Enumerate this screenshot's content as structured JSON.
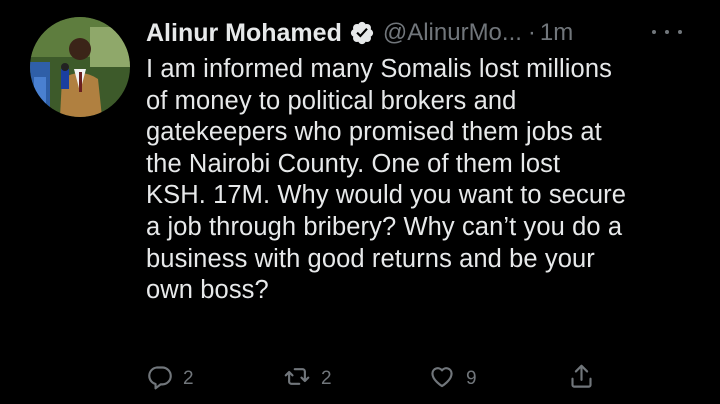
{
  "tweet": {
    "author_name": "Alinur Mohamed",
    "handle": "@AlinurMo...",
    "separator": "·",
    "timestamp": "1m",
    "verified_icon": "verified-badge-icon",
    "more_icon": "more-options-icon",
    "text": "I am informed many Somalis lost millions\nof money to political brokers and\ngatekeepers who promised them jobs at\nthe Nairobi County. One of them lost\nKSH. 17M. Why would you want to secure\na job through bribery? Why can’t you do a\nbusiness with good returns and be your\nown boss?",
    "actions": {
      "reply_count": "2",
      "retweet_count": "2",
      "like_count": "9"
    }
  },
  "colors": {
    "background": "#000000",
    "text": "#e7e9ea",
    "muted": "#71767b",
    "verified": "#e7e9ea"
  }
}
